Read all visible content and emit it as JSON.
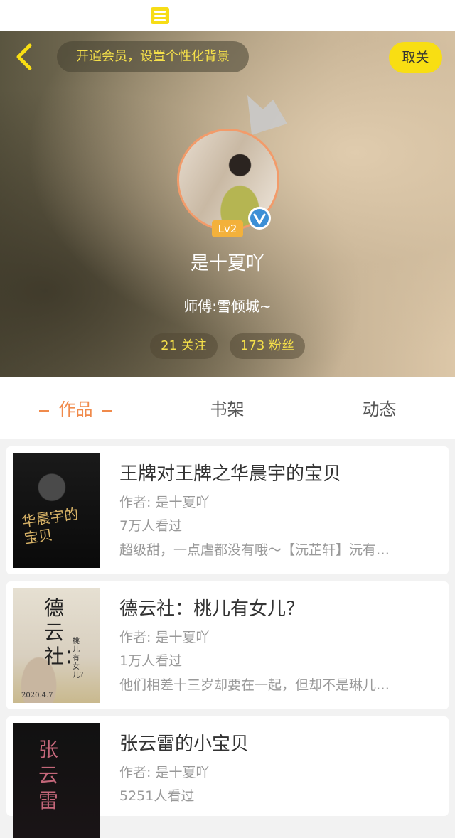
{
  "header": {
    "vip_banner": "开通会员，设置个性化背景",
    "unfollow_label": "取关",
    "level": "Lv2",
    "username": "是十夏吖",
    "master": "师傅:雪倾城~",
    "following": "21 关注",
    "followers": "173 粉丝"
  },
  "tabs": [
    {
      "label": "作品",
      "active": true
    },
    {
      "label": "书架",
      "active": false
    },
    {
      "label": "动态",
      "active": false
    }
  ],
  "books": [
    {
      "title": "王牌对王牌之华晨宇的宝贝",
      "author": "作者: 是十夏吖",
      "views": "7万人看过",
      "desc": "超级甜，一点虐都没有哦～【沅芷轩】沅有…",
      "cover_text": "华晨宇的宝贝"
    },
    {
      "title": "德云社：桃儿有女儿？",
      "author": "作者: 是十夏吖",
      "views": "1万人看过",
      "desc": "他们相差十三岁却要在一起，但却不是琳儿…",
      "cover_text": "德云社：",
      "cover_sub": "桃儿有女儿？",
      "cover_date": "2020.4.7"
    },
    {
      "title": "张云雷的小宝贝",
      "author": "作者: 是十夏吖",
      "views": "5251人看过",
      "desc": "",
      "cover_text": "张云雷"
    }
  ],
  "colors": {
    "accent_yellow": "#f8de13",
    "tab_active": "#f08a4b",
    "avatar_ring": "#f29b6a",
    "level_badge": "#f3b13b",
    "verified": "#3c8fd6"
  }
}
